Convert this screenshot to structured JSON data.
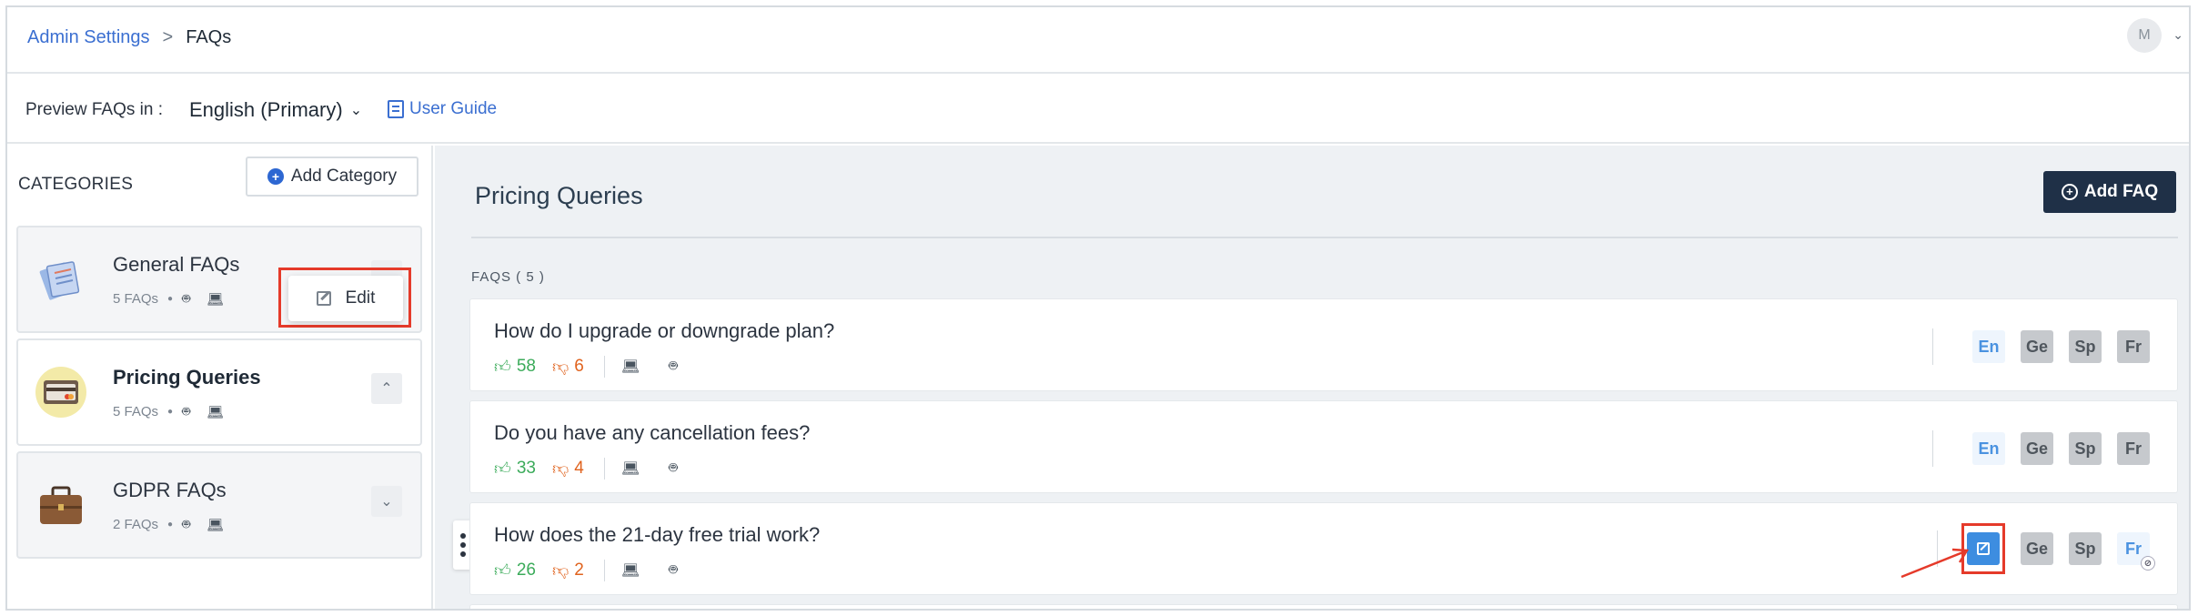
{
  "breadcrumb": {
    "parent": "Admin Settings",
    "separator": ">",
    "current": "FAQs"
  },
  "user": {
    "avatar_initial": "M"
  },
  "preview": {
    "label": "Preview FAQs in :",
    "language": "English (Primary)",
    "guide_label": "User Guide"
  },
  "categories": {
    "heading": "CATEGORIES",
    "add_label": "Add Category",
    "items": [
      {
        "name": "General FAQs",
        "count": "5 FAQs"
      },
      {
        "name": "Pricing Queries",
        "count": "5 FAQs"
      },
      {
        "name": "GDPR FAQs",
        "count": "2 FAQs"
      }
    ],
    "edit_menu_label": "Edit"
  },
  "main": {
    "title": "Pricing Queries",
    "add_faq_label": "Add FAQ",
    "faqs_count_label": "FAQS ( 5 )",
    "faqs": [
      {
        "question": "How do I upgrade or downgrade plan?",
        "up": "58",
        "down": "6",
        "langs": [
          "En",
          "Ge",
          "Sp",
          "Fr"
        ]
      },
      {
        "question": "Do you have any cancellation fees?",
        "up": "33",
        "down": "4",
        "langs": [
          "En",
          "Ge",
          "Sp",
          "Fr"
        ]
      },
      {
        "question": "How does the 21-day free trial work?",
        "up": "26",
        "down": "2",
        "langs": [
          "Ge",
          "Sp",
          "Fr"
        ]
      }
    ]
  },
  "colors": {
    "accent": "#3b6fd1",
    "dark_button": "#1f3047",
    "highlight": "#e53a2a",
    "upvote": "#3bab5a",
    "downvote": "#e0631e"
  }
}
